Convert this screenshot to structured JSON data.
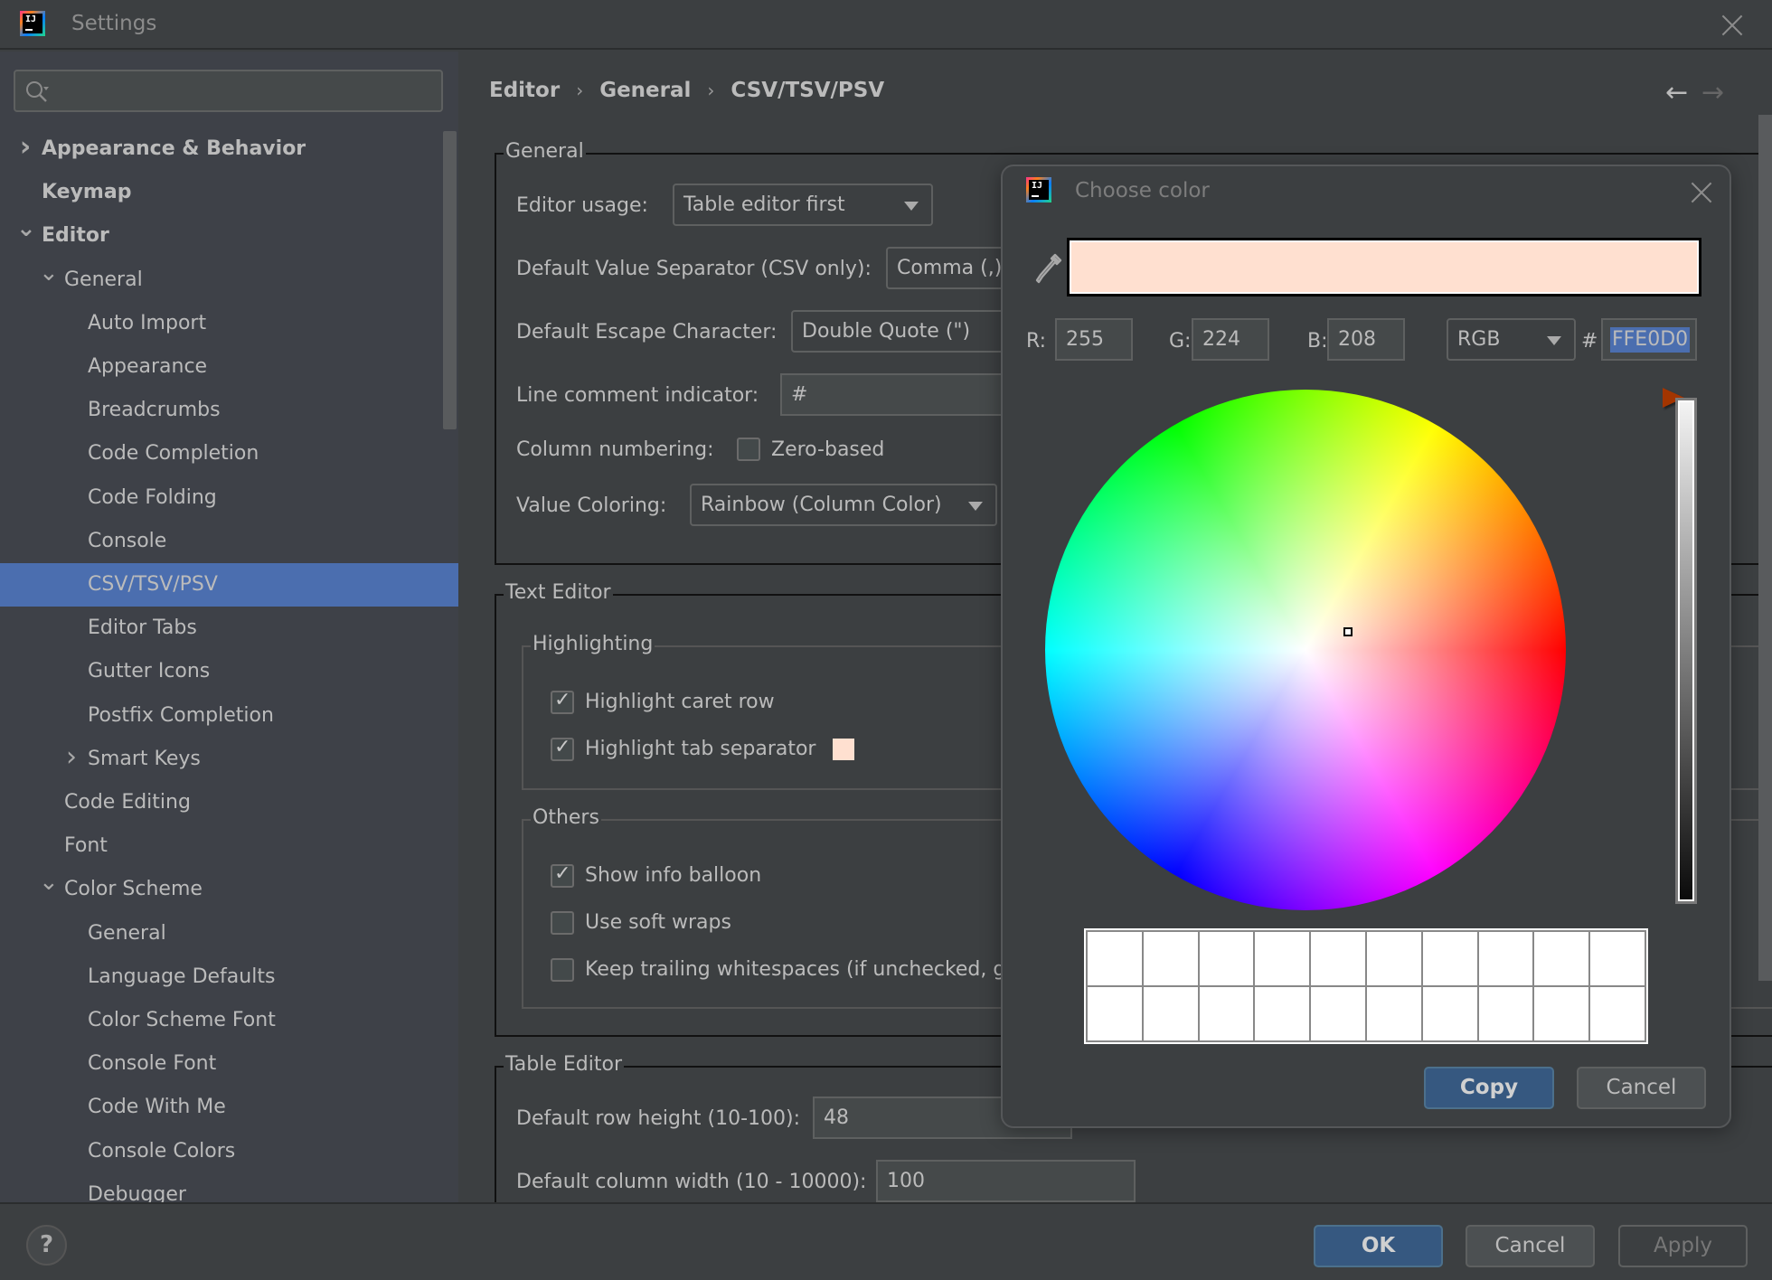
{
  "window": {
    "title": "Settings",
    "logo_text": "IJ"
  },
  "search": {
    "placeholder": "",
    "value": ""
  },
  "sidebar": {
    "items": [
      {
        "label": "Appearance & Behavior",
        "level": 0,
        "bold": true,
        "chevron": "right"
      },
      {
        "label": "Keymap",
        "level": 0,
        "bold": true,
        "chevron": ""
      },
      {
        "label": "Editor",
        "level": 0,
        "bold": true,
        "chevron": "down"
      },
      {
        "label": "General",
        "level": 1,
        "bold": false,
        "chevron": "down"
      },
      {
        "label": "Auto Import",
        "level": 2,
        "bold": false,
        "chevron": ""
      },
      {
        "label": "Appearance",
        "level": 2,
        "bold": false,
        "chevron": ""
      },
      {
        "label": "Breadcrumbs",
        "level": 2,
        "bold": false,
        "chevron": ""
      },
      {
        "label": "Code Completion",
        "level": 2,
        "bold": false,
        "chevron": ""
      },
      {
        "label": "Code Folding",
        "level": 2,
        "bold": false,
        "chevron": ""
      },
      {
        "label": "Console",
        "level": 2,
        "bold": false,
        "chevron": ""
      },
      {
        "label": "CSV/TSV/PSV",
        "level": 2,
        "bold": false,
        "chevron": "",
        "selected": true
      },
      {
        "label": "Editor Tabs",
        "level": 2,
        "bold": false,
        "chevron": ""
      },
      {
        "label": "Gutter Icons",
        "level": 2,
        "bold": false,
        "chevron": ""
      },
      {
        "label": "Postfix Completion",
        "level": 2,
        "bold": false,
        "chevron": ""
      },
      {
        "label": "Smart Keys",
        "level": 2,
        "bold": false,
        "chevron": "right"
      },
      {
        "label": "Code Editing",
        "level": 1,
        "bold": false,
        "chevron": ""
      },
      {
        "label": "Font",
        "level": 1,
        "bold": false,
        "chevron": ""
      },
      {
        "label": "Color Scheme",
        "level": 1,
        "bold": false,
        "chevron": "down"
      },
      {
        "label": "General",
        "level": 2,
        "bold": false,
        "chevron": ""
      },
      {
        "label": "Language Defaults",
        "level": 2,
        "bold": false,
        "chevron": ""
      },
      {
        "label": "Color Scheme Font",
        "level": 2,
        "bold": false,
        "chevron": ""
      },
      {
        "label": "Console Font",
        "level": 2,
        "bold": false,
        "chevron": ""
      },
      {
        "label": "Code With Me",
        "level": 2,
        "bold": false,
        "chevron": ""
      },
      {
        "label": "Console Colors",
        "level": 2,
        "bold": false,
        "chevron": ""
      },
      {
        "label": "Debugger",
        "level": 2,
        "bold": false,
        "chevron": ""
      }
    ]
  },
  "breadcrumb": [
    "Editor",
    "General",
    "CSV/TSV/PSV"
  ],
  "nav": {
    "back": "←",
    "forward": "→"
  },
  "general_section": {
    "title": "General",
    "editor_usage_label": "Editor usage:",
    "editor_usage_value": "Table editor first",
    "separator_label": "Default Value Separator (CSV only):",
    "separator_value": "Comma (,)",
    "escape_label": "Default Escape Character:",
    "escape_value": "Double Quote (\")",
    "line_comment_label": "Line comment indicator:",
    "line_comment_value": "#",
    "column_numbering_label": "Column numbering:",
    "zero_based_label": "Zero-based",
    "zero_based_checked": false,
    "value_coloring_label": "Value Coloring:",
    "value_coloring_value": "Rainbow (Column Color)"
  },
  "text_editor_section": {
    "title": "Text Editor",
    "highlighting": {
      "title": "Highlighting",
      "highlight_caret_row_label": "Highlight caret row",
      "highlight_caret_row_checked": true,
      "highlight_tab_separator_label": "Highlight tab separator",
      "highlight_tab_separator_checked": true,
      "tab_separator_color": "#FFE0D0"
    },
    "others": {
      "title": "Others",
      "show_info_balloon_label": "Show info balloon",
      "show_info_balloon_checked": true,
      "use_soft_wraps_label": "Use soft wraps",
      "use_soft_wraps_checked": false,
      "keep_trailing_label": "Keep trailing whitespaces (if unchecked, ge",
      "keep_trailing_checked": false
    }
  },
  "table_editor_section": {
    "title": "Table Editor",
    "row_height_label": "Default row height (10-100):",
    "row_height_value": "48",
    "column_width_label": "Default column width (10 - 10000):",
    "column_width_value": "100"
  },
  "footer": {
    "help": "?",
    "ok": "OK",
    "cancel": "Cancel",
    "apply": "Apply"
  },
  "color_dialog": {
    "title": "Choose color",
    "logo_text": "IJ",
    "preview_color": "#FFE0D0",
    "r_label": "R:",
    "r_value": "255",
    "g_label": "G:",
    "g_value": "224",
    "b_label": "B:",
    "b_value": "208",
    "mode_value": "RGB",
    "hash_label": "#",
    "hex_value": "FFE0D0",
    "brightness": 1.0,
    "hue_degrees": 20,
    "saturation": 0.18,
    "recent_colors": [
      "#FFFFFF",
      "#FFFFFF",
      "#FFFFFF",
      "#FFFFFF",
      "#FFFFFF",
      "#FFFFFF",
      "#FFFFFF",
      "#FFFFFF",
      "#FFFFFF",
      "#FFFFFF",
      "#FFFFFF",
      "#FFFFFF",
      "#FFFFFF",
      "#FFFFFF",
      "#FFFFFF",
      "#FFFFFF",
      "#FFFFFF",
      "#FFFFFF",
      "#FFFFFF",
      "#FFFFFF"
    ],
    "copy_label": "Copy",
    "cancel_label": "Cancel"
  },
  "colors": {
    "accent": "#4B6EAF",
    "primary_button": "#365880",
    "slider_thumb": "#A33500"
  }
}
